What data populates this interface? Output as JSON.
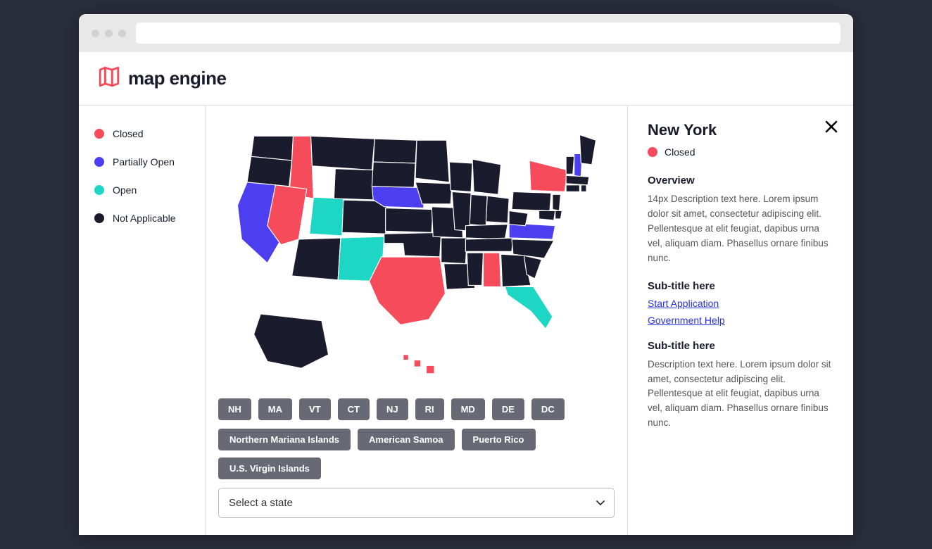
{
  "colors": {
    "closed": "#f64b5a",
    "partially_open": "#4b3ff0",
    "open": "#1ed6c4",
    "not_applicable": "#1a1c2e"
  },
  "header": {
    "brand": "map engine"
  },
  "legend": [
    {
      "label": "Closed",
      "color": "#f64b5a"
    },
    {
      "label": "Partially Open",
      "color": "#4b3ff0"
    },
    {
      "label": "Open",
      "color": "#1ed6c4"
    },
    {
      "label": "Not Applicable",
      "color": "#1a1c2e"
    }
  ],
  "state_chips_small": [
    "NH",
    "MA",
    "VT",
    "CT",
    "NJ",
    "RI",
    "MD",
    "DE",
    "DC"
  ],
  "territory_chips": [
    "Northern Mariana Islands",
    "American Samoa",
    "Puerto Rico",
    "U.S. Virgin Islands"
  ],
  "select_placeholder": "Select a state",
  "map": {
    "highlighted_states": {
      "ID": "closed",
      "NV": "closed",
      "NY": "closed",
      "TX": "closed",
      "AL": "closed",
      "HI": "closed",
      "CA": "partially_open",
      "NE": "partially_open",
      "VA": "partially_open",
      "NH": "partially_open",
      "UT": "open",
      "NM": "open",
      "FL": "open"
    },
    "default_status": "not_applicable"
  },
  "detail": {
    "state": "New York",
    "status_label": "Closed",
    "status_color": "#f64b5a",
    "overview_heading": "Overview",
    "overview_text": "14px Description text here. Lorem ipsum dolor sit amet, consectetur adipiscing elit. Pellentesque at elit feugiat, dapibus urna vel, aliquam diam. Phasellus ornare finibus nunc.",
    "section2_heading": "Sub-title here",
    "links": [
      {
        "label": "Start Application"
      },
      {
        "label": "Government Help"
      }
    ],
    "section3_heading": "Sub-title here",
    "section3_text": "Description text here. Lorem ipsum dolor sit amet, consectetur adipiscing elit. Pellentesque at elit feugiat, dapibus urna vel, aliquam diam. Phasellus ornare finibus nunc."
  }
}
